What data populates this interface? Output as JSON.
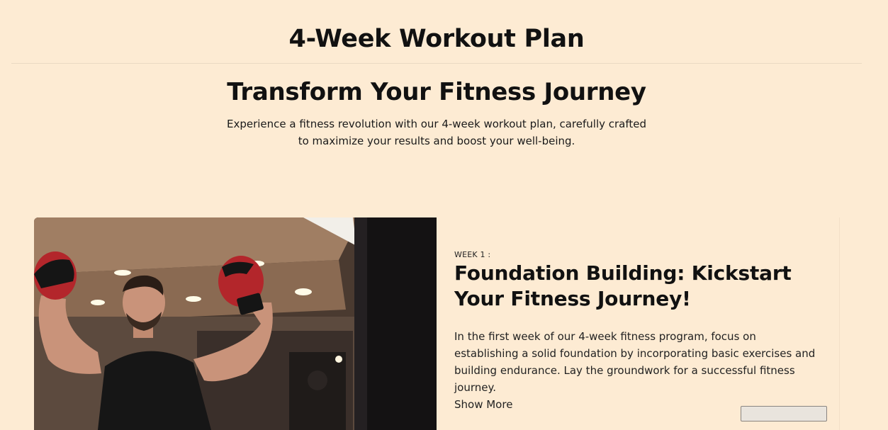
{
  "header": {
    "title": "4-Week Workout Plan"
  },
  "hero": {
    "title": "Transform Your Fitness Journey",
    "subtitle": "Experience a fitness revolution with our 4-week workout plan, carefully crafted to maximize your results and boost your well-being."
  },
  "weeks": [
    {
      "label": "WEEK 1 :",
      "title": "Foundation Building: Kickstart Your Fitness Journey!",
      "description": "In the first week of our 4-week fitness program, focus on establishing a solid foundation by incorporating basic exercises and building endurance. Lay the groundwork for a successful fitness journey.",
      "show_more": "Show More",
      "image_subject": "boxer-celebrating-in-gym"
    }
  ],
  "colors": {
    "background": "#fdebd3",
    "text": "#111111",
    "divider": "#ead9c3",
    "glove_red": "#b3262b"
  }
}
